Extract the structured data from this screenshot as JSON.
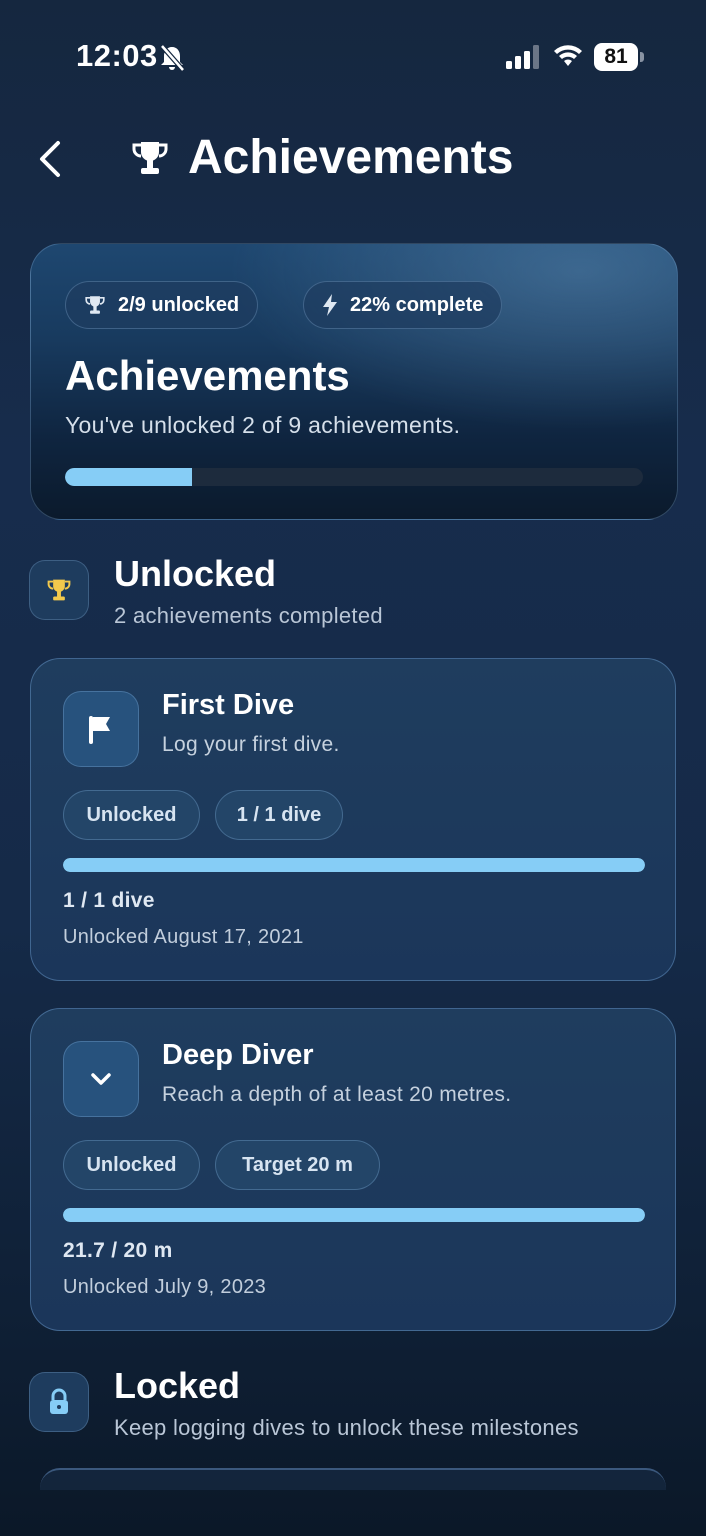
{
  "status_bar": {
    "time": "12:03",
    "battery": "81"
  },
  "header": {
    "title": "Achievements"
  },
  "summary": {
    "unlocked_chip": "2/9 unlocked",
    "complete_chip": "22% complete",
    "title": "Achievements",
    "subtitle": "You've unlocked 2 of 9 achievements.",
    "progress_fraction": 0.22
  },
  "sections": {
    "unlocked": {
      "title": "Unlocked",
      "subtitle": "2 achievements completed"
    },
    "locked": {
      "title": "Locked",
      "subtitle": "Keep logging dives to unlock these milestones"
    }
  },
  "achievements": [
    {
      "icon": "flag-icon",
      "title": "First Dive",
      "description": "Log your first dive.",
      "status": "Unlocked",
      "detail_chip": "1 / 1 dive",
      "progress_text": "1 / 1 dive",
      "progress_fraction": 1.0,
      "unlocked_date": "Unlocked August 17, 2021"
    },
    {
      "icon": "chevron-down-icon",
      "title": "Deep Diver",
      "description": "Reach a depth of at least 20 metres.",
      "status": "Unlocked",
      "detail_chip": "Target 20 m",
      "progress_text": "21.7 / 20 m",
      "progress_fraction": 1.0,
      "unlocked_date": "Unlocked July 9, 2023"
    }
  ],
  "colors": {
    "accent": "#86cdf6",
    "trophy_gold": "#f2c94c"
  }
}
